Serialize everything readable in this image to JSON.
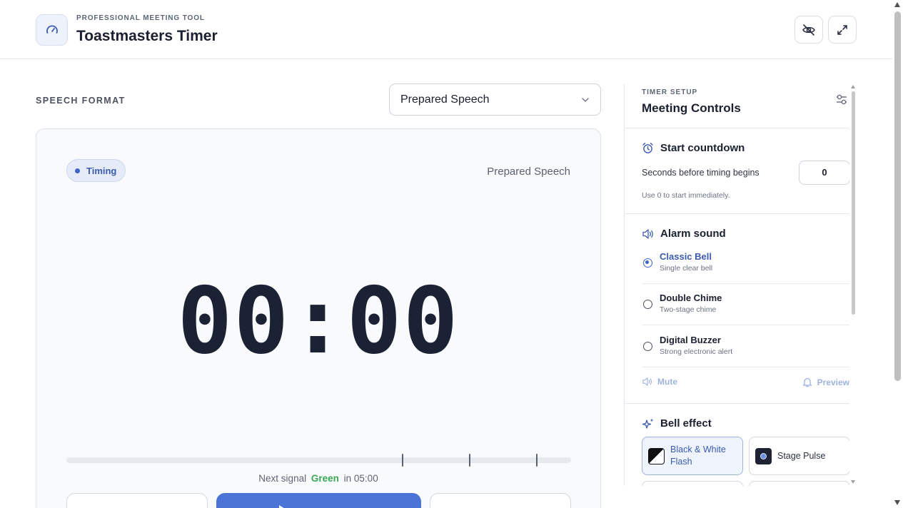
{
  "header": {
    "eyebrow": "PROFESSIONAL MEETING TOOL",
    "title": "Toastmasters Timer",
    "logo_icon": "speedometer-icon",
    "buttons": [
      {
        "icon": "eye-off-icon"
      },
      {
        "icon": "expand-icon"
      }
    ]
  },
  "main": {
    "format_label": "SPEECH FORMAT",
    "format_selected": "Prepared Speech",
    "status_pill": "Timing",
    "card_format": "Prepared Speech",
    "clock": "00:00",
    "next_signal_prefix": "Next signal",
    "next_signal_color": "Green",
    "next_signal_suffix": "in 05:00"
  },
  "panel": {
    "eyebrow": "TIMER SETUP",
    "title": "Meeting Controls",
    "countdown": {
      "title": "Start countdown",
      "label": "Seconds before timing begins",
      "value": "0",
      "hint": "Use 0 to start immediately."
    },
    "alarm": {
      "title": "Alarm sound",
      "options": [
        {
          "name": "Classic Bell",
          "desc": "Single clear bell",
          "selected": true
        },
        {
          "name": "Double Chime",
          "desc": "Two-stage chime",
          "selected": false
        },
        {
          "name": "Digital Buzzer",
          "desc": "Strong electronic alert",
          "selected": false
        }
      ],
      "mute_label": "Mute",
      "preview_label": "Preview"
    },
    "bell_effect": {
      "title": "Bell effect",
      "options": [
        {
          "name": "Black & White Flash",
          "selected": true
        },
        {
          "name": "Stage Pulse",
          "selected": false
        }
      ]
    }
  },
  "colors": {
    "accent": "#4a74d6",
    "green": "#3aa856",
    "text": "#1b2030"
  }
}
